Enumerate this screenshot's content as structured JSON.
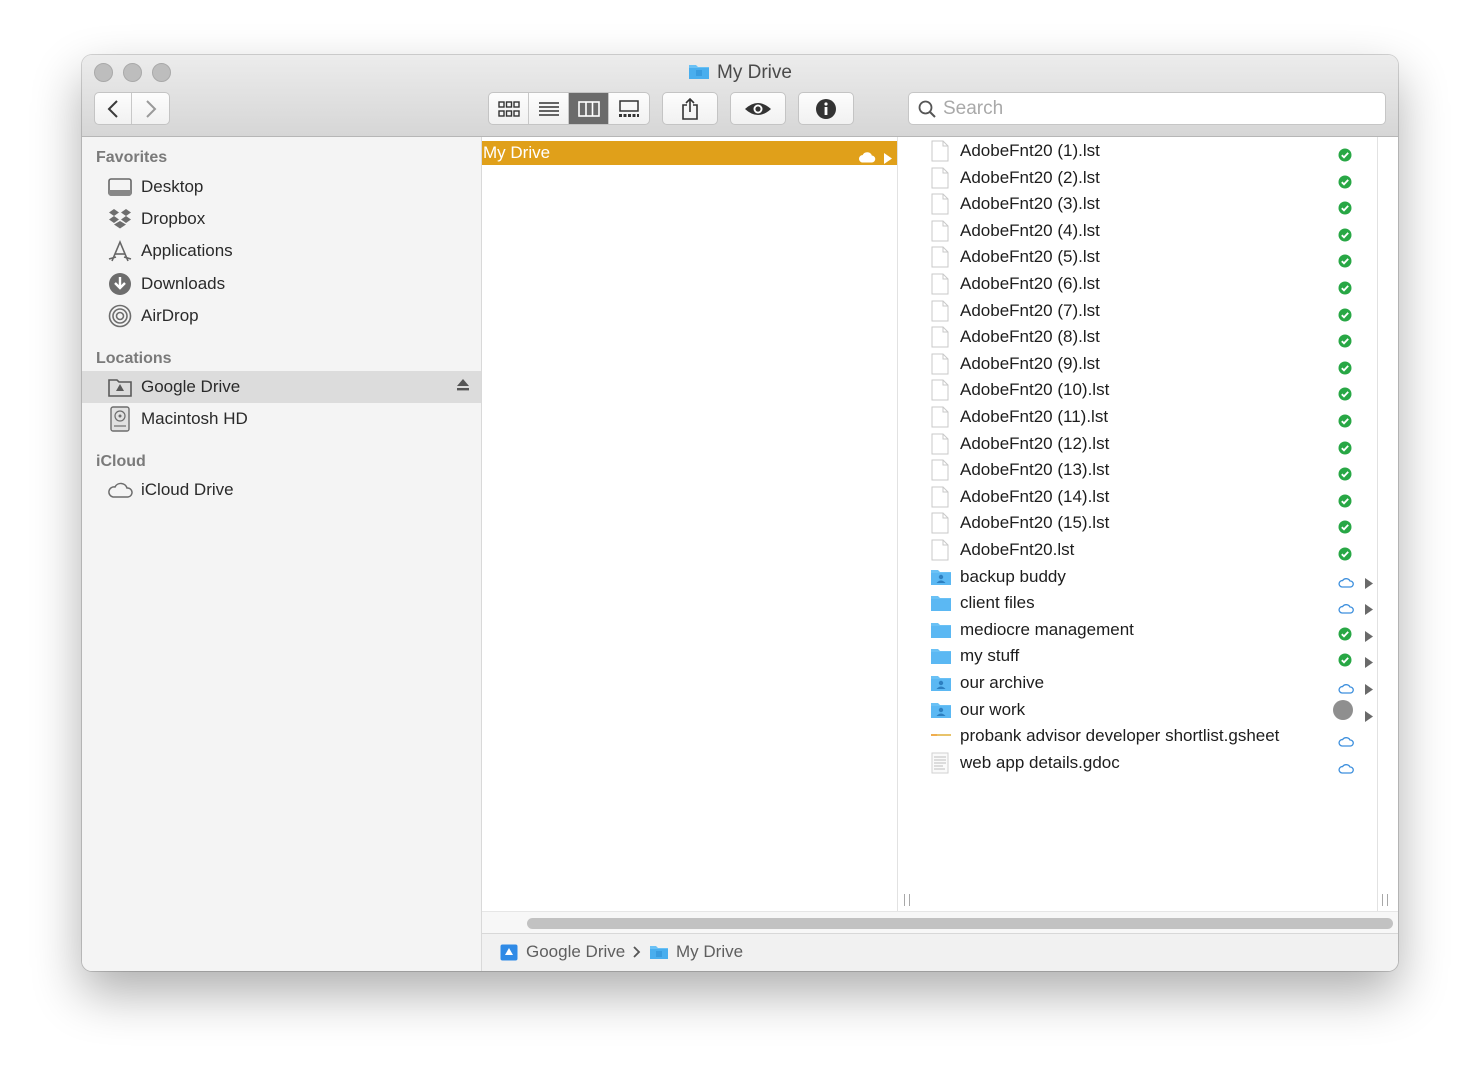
{
  "window": {
    "title": "My Drive"
  },
  "toolbar": {
    "back_icon": "chevron-left-icon",
    "forward_icon": "chevron-right-icon",
    "view_modes": [
      "icon-view",
      "list-view",
      "column-view",
      "gallery-view"
    ],
    "active_view": "column-view",
    "share_icon": "share-icon",
    "quicklook_icon": "eye-icon",
    "info_icon": "info-icon",
    "search_placeholder": "Search"
  },
  "sidebar": {
    "favorites_header": "Favorites",
    "favorites": [
      {
        "label": "Desktop",
        "icon": "desktop-icon"
      },
      {
        "label": "Dropbox",
        "icon": "dropbox-icon"
      },
      {
        "label": "Applications",
        "icon": "applications-icon"
      },
      {
        "label": "Downloads",
        "icon": "downloads-icon"
      },
      {
        "label": "AirDrop",
        "icon": "airdrop-icon"
      }
    ],
    "locations_header": "Locations",
    "locations": [
      {
        "label": "Google Drive",
        "icon": "google-drive-icon",
        "selected": true,
        "ejectable": true
      },
      {
        "label": "Macintosh HD",
        "icon": "hard-drive-icon"
      }
    ],
    "icloud_header": "iCloud",
    "icloud": [
      {
        "label": "iCloud Drive",
        "icon": "cloud-icon"
      }
    ]
  },
  "column1": {
    "selected_item": "My Drive"
  },
  "column2": {
    "items": [
      {
        "name": "AdobeFnt20 (1).lst",
        "kind": "file",
        "status": "synced"
      },
      {
        "name": "AdobeFnt20 (2).lst",
        "kind": "file",
        "status": "synced"
      },
      {
        "name": "AdobeFnt20 (3).lst",
        "kind": "file",
        "status": "synced"
      },
      {
        "name": "AdobeFnt20 (4).lst",
        "kind": "file",
        "status": "synced"
      },
      {
        "name": "AdobeFnt20 (5).lst",
        "kind": "file",
        "status": "synced"
      },
      {
        "name": "AdobeFnt20 (6).lst",
        "kind": "file",
        "status": "synced"
      },
      {
        "name": "AdobeFnt20 (7).lst",
        "kind": "file",
        "status": "synced"
      },
      {
        "name": "AdobeFnt20 (8).lst",
        "kind": "file",
        "status": "synced"
      },
      {
        "name": "AdobeFnt20 (9).lst",
        "kind": "file",
        "status": "synced"
      },
      {
        "name": "AdobeFnt20 (10).lst",
        "kind": "file",
        "status": "synced"
      },
      {
        "name": "AdobeFnt20 (11).lst",
        "kind": "file",
        "status": "synced"
      },
      {
        "name": "AdobeFnt20 (12).lst",
        "kind": "file",
        "status": "synced"
      },
      {
        "name": "AdobeFnt20 (13).lst",
        "kind": "file",
        "status": "synced"
      },
      {
        "name": "AdobeFnt20 (14).lst",
        "kind": "file",
        "status": "synced"
      },
      {
        "name": "AdobeFnt20 (15).lst",
        "kind": "file",
        "status": "synced"
      },
      {
        "name": "AdobeFnt20.lst",
        "kind": "file",
        "status": "synced"
      },
      {
        "name": "backup buddy",
        "kind": "shared-folder",
        "status": "cloud"
      },
      {
        "name": "client files",
        "kind": "folder",
        "status": "cloud"
      },
      {
        "name": "mediocre management",
        "kind": "folder",
        "status": "synced"
      },
      {
        "name": "my stuff",
        "kind": "folder",
        "status": "synced"
      },
      {
        "name": "our archive",
        "kind": "shared-folder",
        "status": "cloud"
      },
      {
        "name": "our work",
        "kind": "shared-folder",
        "status": "pending"
      },
      {
        "name": "probank advisor developer shortlist.gsheet",
        "kind": "sheet",
        "status": "cloud"
      },
      {
        "name": "web app details.gdoc",
        "kind": "doc",
        "status": "cloud"
      }
    ]
  },
  "pathbar": {
    "items": [
      "Google Drive",
      "My Drive"
    ]
  },
  "colors": {
    "selection": "#e0a01a",
    "synced_green": "#28a745",
    "cloud_blue": "#3d8fdd",
    "folder_blue": "#6ac1f5"
  }
}
